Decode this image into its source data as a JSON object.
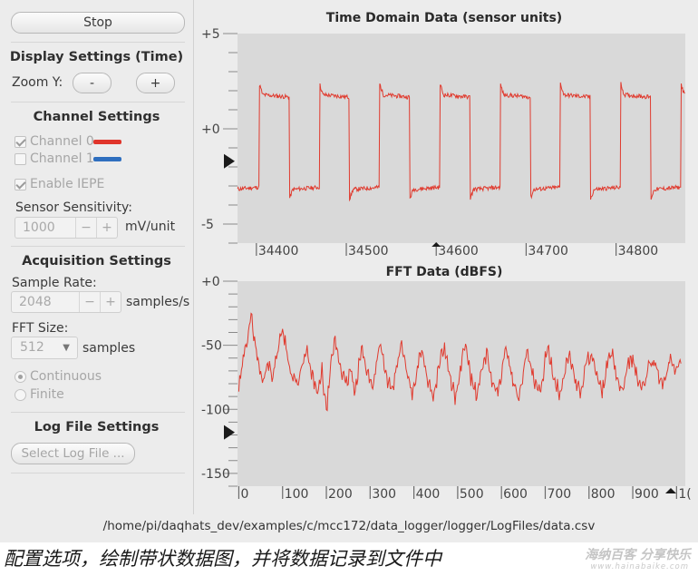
{
  "controls": {
    "stop_label": "Stop",
    "display": {
      "title": "Display Settings (Time)",
      "zoom_label": "Zoom Y:",
      "zoom_out_label": "-",
      "zoom_in_label": "+"
    },
    "channels": {
      "title": "Channel Settings",
      "ch0_label": "Channel 0",
      "ch0_checked": true,
      "ch0_color": "#e0352b",
      "ch1_label": "Channel 1",
      "ch1_checked": false,
      "ch1_color": "#2f6fbf",
      "iepe_label": "Enable IEPE",
      "iepe_checked": true,
      "sensitivity_label": "Sensor Sensitivity:",
      "sensitivity_value": "1000",
      "sensitivity_unit": "mV/unit",
      "minus": "−",
      "plus": "+"
    },
    "acquisition": {
      "title": "Acquisition Settings",
      "rate_label": "Sample Rate:",
      "rate_value": "2048",
      "rate_unit": "samples/s",
      "fft_label": "FFT Size:",
      "fft_value": "512",
      "fft_unit": "samples",
      "continuous_label": "Continuous",
      "finite_label": "Finite",
      "mode": "continuous"
    },
    "log": {
      "title": "Log File Settings",
      "select_label": "Select Log File ..."
    }
  },
  "status_path": "/home/pi/daqhats_dev/examples/c/mcc172/data_logger/logger/LogFiles/data.csv",
  "caption": "配置选项，绘制带状数据图，并将数据记录到文件中",
  "watermark": "海纳百客 分享快乐",
  "watermark_url": "www.hainabaike.com",
  "chart_data": [
    {
      "type": "line",
      "title": "Time Domain Data (sensor units)",
      "xlabel": "",
      "ylabel": "",
      "x_ticks": [
        "34400",
        "34500",
        "34600",
        "34700",
        "34800"
      ],
      "y_ticks": [
        "+5",
        "+0",
        "-5"
      ],
      "xlim": [
        34379,
        34877
      ],
      "ylim": [
        -6,
        5
      ],
      "series": [
        {
          "color": "#e03a2e",
          "waveform": "square",
          "high": 1.8,
          "low": -3.2,
          "period": 67,
          "first_rise": 34403,
          "duty": 0.5
        }
      ]
    },
    {
      "type": "line",
      "title": "FFT Data (dBFS)",
      "xlabel": "",
      "ylabel": "",
      "x_ticks": [
        "0",
        "100",
        "200",
        "300",
        "400",
        "500",
        "600",
        "700",
        "800",
        "900",
        "1("
      ],
      "y_ticks": [
        "+0",
        "-50",
        "-100",
        "-150"
      ],
      "xlim": [
        -3,
        1020
      ],
      "ylim": [
        -160,
        0
      ],
      "series": [
        {
          "color": "#e03a2e",
          "fundamental_hz": 30.5,
          "points": [
            [
              0,
              -85
            ],
            [
              10,
              -62
            ],
            [
              20,
              -42
            ],
            [
              27,
              -27
            ],
            [
              34,
              -40
            ],
            [
              45,
              -65
            ],
            [
              55,
              -80
            ],
            [
              65,
              -62
            ],
            [
              78,
              -74
            ],
            [
              92,
              -48
            ],
            [
              100,
              -37
            ],
            [
              110,
              -54
            ],
            [
              120,
              -75
            ],
            [
              135,
              -80
            ],
            [
              150,
              -60
            ],
            [
              155,
              -54
            ],
            [
              165,
              -72
            ],
            [
              182,
              -88
            ],
            [
              190,
              -70
            ],
            [
              200,
              -102
            ],
            [
              212,
              -62
            ],
            [
              220,
              -45
            ],
            [
              228,
              -60
            ],
            [
              245,
              -82
            ],
            [
              256,
              -68
            ],
            [
              265,
              -90
            ],
            [
              280,
              -52
            ],
            [
              292,
              -68
            ],
            [
              305,
              -84
            ],
            [
              315,
              -62
            ],
            [
              322,
              -48
            ],
            [
              335,
              -72
            ],
            [
              350,
              -88
            ],
            [
              365,
              -58
            ],
            [
              372,
              -50
            ],
            [
              385,
              -74
            ],
            [
              398,
              -88
            ],
            [
              410,
              -62
            ],
            [
              420,
              -54
            ],
            [
              432,
              -78
            ],
            [
              445,
              -90
            ],
            [
              458,
              -64
            ],
            [
              470,
              -52
            ],
            [
              482,
              -74
            ],
            [
              495,
              -92
            ],
            [
              510,
              -62
            ],
            [
              518,
              -48
            ],
            [
              530,
              -76
            ],
            [
              545,
              -90
            ],
            [
              558,
              -64
            ],
            [
              566,
              -56
            ],
            [
              580,
              -80
            ],
            [
              592,
              -88
            ],
            [
              605,
              -62
            ],
            [
              612,
              -52
            ],
            [
              625,
              -76
            ],
            [
              640,
              -92
            ],
            [
              652,
              -64
            ],
            [
              660,
              -56
            ],
            [
              675,
              -80
            ],
            [
              688,
              -88
            ],
            [
              700,
              -62
            ],
            [
              708,
              -54
            ],
            [
              722,
              -78
            ],
            [
              735,
              -90
            ],
            [
              748,
              -64
            ],
            [
              756,
              -56
            ],
            [
              770,
              -80
            ],
            [
              782,
              -86
            ],
            [
              795,
              -62
            ],
            [
              805,
              -56
            ],
            [
              818,
              -76
            ],
            [
              830,
              -88
            ],
            [
              842,
              -64
            ],
            [
              852,
              -56
            ],
            [
              865,
              -78
            ],
            [
              878,
              -86
            ],
            [
              890,
              -64
            ],
            [
              900,
              -60
            ],
            [
              912,
              -78
            ],
            [
              925,
              -84
            ],
            [
              938,
              -64
            ],
            [
              948,
              -62
            ],
            [
              960,
              -76
            ],
            [
              972,
              -80
            ],
            [
              985,
              -60
            ],
            [
              1000,
              -70
            ],
            [
              1010,
              -62
            ]
          ]
        }
      ]
    }
  ]
}
